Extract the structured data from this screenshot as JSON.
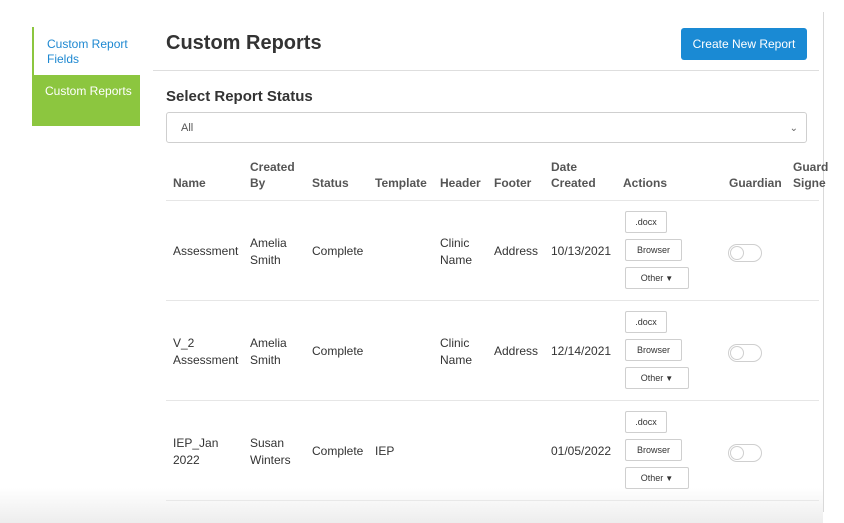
{
  "sidebar": {
    "items": [
      {
        "label": "Custom Report Fields"
      },
      {
        "label": "Custom Reports"
      }
    ]
  },
  "header": {
    "title": "Custom Reports",
    "create_button": "Create New Report"
  },
  "filter": {
    "section_title": "Select Report Status",
    "selected": "All"
  },
  "table": {
    "columns": {
      "name": "Name",
      "created_by_1": "Created",
      "created_by_2": "By",
      "status": "Status",
      "template": "Template",
      "header": "Header",
      "footer": "Footer",
      "date_1": "Date",
      "date_2": "Created",
      "actions": "Actions",
      "guardian": "Guardian",
      "guardian_sig_1": "Guard",
      "guardian_sig_2": "Signe"
    },
    "action_labels": {
      "docx": ".docx",
      "browser": "Browser",
      "other": "Other"
    },
    "rows": [
      {
        "name_1": "Assessment",
        "name_2": "",
        "created_by_1": "Amelia",
        "created_by_2": "Smith",
        "status": "Complete",
        "template": "",
        "header_1": "Clinic",
        "header_2": "Name",
        "footer": "Address",
        "date": "10/13/2021",
        "guardian_on": false
      },
      {
        "name_1": "V_2",
        "name_2": "Assessment",
        "created_by_1": "Amelia",
        "created_by_2": "Smith",
        "status": "Complete",
        "template": "",
        "header_1": "Clinic",
        "header_2": "Name",
        "footer": "Address",
        "date": "12/14/2021",
        "guardian_on": false
      },
      {
        "name_1": "IEP_Jan",
        "name_2": "2022",
        "created_by_1": "Susan",
        "created_by_2": "Winters",
        "status": "Complete",
        "template": "IEP",
        "header_1": "",
        "header_2": "",
        "footer": "",
        "date": "01/05/2022",
        "guardian_on": false
      }
    ]
  }
}
